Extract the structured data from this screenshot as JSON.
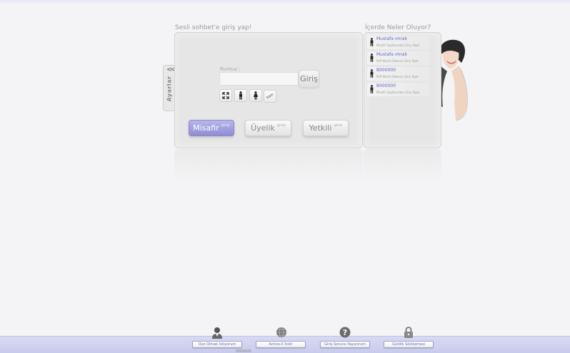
{
  "login": {
    "title": "Sesli sohbet'e giriş yap!",
    "nickname_label": "Rumuz :",
    "nickname_value": "",
    "login_button": "Giriş",
    "cam_label": "kam",
    "types": [
      {
        "label": "Misafir",
        "sub": "girişi"
      },
      {
        "label": "Üyelik",
        "sub": "girişi"
      },
      {
        "label": "Yetkili",
        "sub": "girişi"
      }
    ]
  },
  "settings": {
    "label": "Ayarlar",
    "chevron": "<<"
  },
  "activity": {
    "title": "İçerde Neler Oluyor?",
    "items": [
      {
        "name": "Mustafa ımrak",
        "message": "Misafir Sayfasından Giriş Yaptı"
      },
      {
        "name": "Mustafa ımrak",
        "message": "PoP Müzik Odasına Giriş Yaptı"
      },
      {
        "name": "B000000",
        "message": "PoP Müzik Odasına Giriş Yaptı"
      },
      {
        "name": "B000000",
        "message": "Misafir Sayfasından Giriş Yaptı"
      }
    ]
  },
  "footer": [
    {
      "label": "Üye Olmak İstiyorum",
      "icon": "user-icon"
    },
    {
      "label": "Active-X İndir",
      "icon": "globe-icon"
    },
    {
      "label": "Giriş Sorunu Yaşıyorum",
      "icon": "help-icon"
    },
    {
      "label": "Gizlilik Sözleşmesi",
      "icon": "lock-icon"
    }
  ],
  "colors": {
    "accent": "#9a98dc",
    "link": "#5b67c4",
    "footer": "#d0d2f0"
  }
}
